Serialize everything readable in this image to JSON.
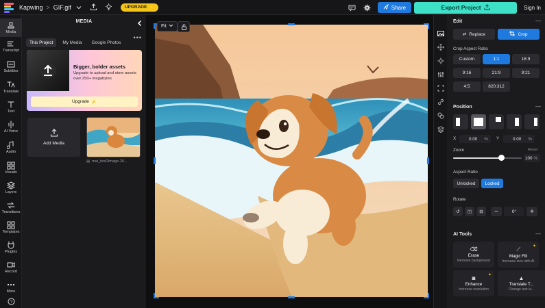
{
  "topbar": {
    "brand": "Kapwing",
    "separator": ">",
    "project": "GIF.gif",
    "upgrade": "UPGRADE",
    "share": "Share",
    "export": "Export Project",
    "signin": "Sign In"
  },
  "leftnav": [
    "Media",
    "Transcript",
    "Subtitles",
    "Translate",
    "Text",
    "AI Voice",
    "Audio",
    "Visuals",
    "Layers",
    "Transitions",
    "Templates",
    "Plugins",
    "Record",
    "More"
  ],
  "media": {
    "title": "MEDIA",
    "tabs": [
      "This Project",
      "My Media",
      "Google Photos"
    ],
    "promo": {
      "title": "Bigger, bolder assets",
      "body": "Upgrade to upload and store assets over 250+ megabytes",
      "button": "Upgrade"
    },
    "add_media": "Add Media",
    "thumb_name": "mai_text2image-20..."
  },
  "canvas": {
    "fit": "Fit"
  },
  "edit": {
    "title": "Edit",
    "replace": "Replace",
    "crop": "Crop",
    "crop_ratio_label": "Crop Aspect Ratio",
    "ratios": [
      "Custom",
      "1:1",
      "16:9",
      "9:16",
      "21:9",
      "9:21",
      "4:5",
      "820:312"
    ],
    "active_ratio": "1:1"
  },
  "position": {
    "title": "Position",
    "x_label": "X",
    "x_value": "0.00",
    "x_unit": "%",
    "y_label": "Y",
    "y_value": "0.00",
    "y_unit": "%",
    "zoom_label": "Zoom",
    "zoom_reset": "Reset",
    "zoom_value": "100",
    "zoom_unit": "%",
    "zoom_level": 0.7,
    "aspect_label": "Aspect Ratio",
    "unlocked": "Unlocked",
    "locked": "Locked",
    "rotate_label": "Rotate",
    "rotate_minus": "−",
    "rotate_value": "0°",
    "rotate_plus": "+"
  },
  "ai_tools": {
    "title": "AI Tools",
    "tools": [
      {
        "name": "Erase",
        "desc": "Remove background"
      },
      {
        "name": "Magic Fill",
        "desc": "Increase size with AI"
      },
      {
        "name": "Enhance",
        "desc": "Increase resolution"
      },
      {
        "name": "Translate T...",
        "desc": "Change text la..."
      }
    ]
  },
  "colors": {
    "accent": "#1f7ae0",
    "export": "#3ee0c8",
    "upgrade": "#f5c518"
  }
}
